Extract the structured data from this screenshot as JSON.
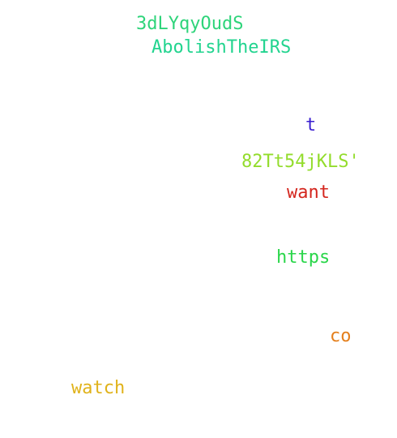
{
  "words": [
    {
      "text": "3dLYqyOudS",
      "color": "#2ed47a"
    },
    {
      "text": "AbolishTheIRS",
      "color": "#22d48f"
    },
    {
      "text": "t",
      "color": "#3a1fd0"
    },
    {
      "text": "82Tt54jKLS'",
      "color": "#93dc2c"
    },
    {
      "text": "want",
      "color": "#d4261e"
    },
    {
      "text": "https",
      "color": "#2ad64a"
    },
    {
      "text": "co",
      "color": "#e47f1c"
    },
    {
      "text": "watch",
      "color": "#e0b21a"
    }
  ]
}
